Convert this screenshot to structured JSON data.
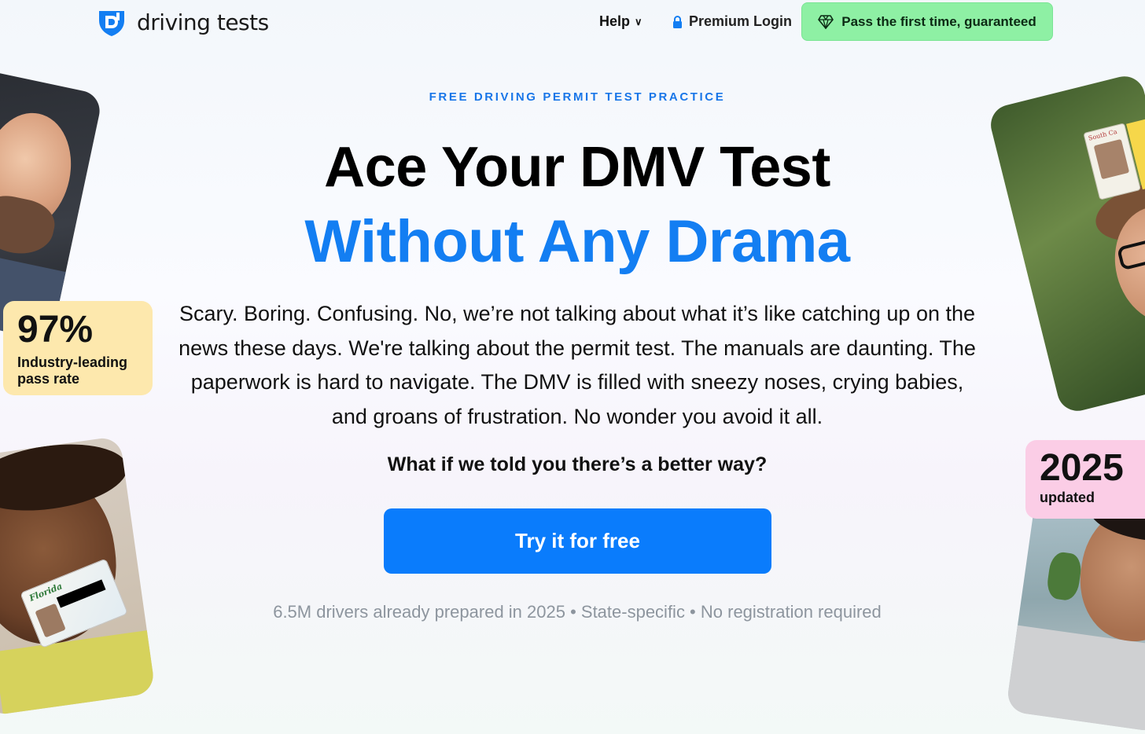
{
  "header": {
    "logo_text": "driving tests",
    "nav_help": "Help",
    "nav_login": "Premium Login",
    "cta_label": "Pass the first time, guaranteed",
    "cta_color": "#8ef0a4"
  },
  "hero": {
    "eyebrow": "FREE DRIVING PERMIT TEST PRACTICE",
    "headline_line1": "Ace Your DMV Test",
    "headline_line2": "Without Any Drama",
    "body": "Scary. Boring. Confusing. No, we’re not talking about what it’s like catching up on the news these days. We're talking about the permit test. The manuals are daunting. The paperwork is hard to navigate. The DMV is filled with sneezy noses, crying babies, and groans of frustration. No wonder you avoid it all.",
    "question": "What if we told you there’s a better way?",
    "cta_label": "Try it for free",
    "trust_line": "6.5M drivers already prepared in 2025 • State-specific • No registration required",
    "accent_color": "#137ef2"
  },
  "badges": {
    "pass_rate": {
      "value": "97%",
      "label": "Industry-leading pass rate",
      "color": "#fde8ad"
    },
    "updated": {
      "value": "2025",
      "label": "updated",
      "color": "#fbcde6"
    }
  },
  "photo_cards": {
    "license_card_state": "Florida",
    "id_card_state": "South Ca"
  },
  "icons": [
    "logo-icon",
    "chevron-down-icon",
    "lock-icon",
    "diamond-icon"
  ]
}
